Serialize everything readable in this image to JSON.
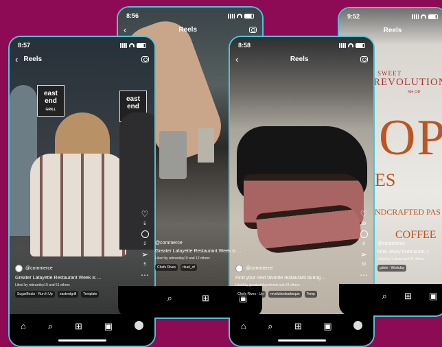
{
  "phones": [
    {
      "time": "8:57",
      "reels_title": "Reels",
      "handle": "@commerce",
      "caption": "Greater Lafayette Restaurant Week is ...",
      "liked": "Liked by rebrantley10 and 61 others",
      "chips": [
        "SugarBeats · Run It Up",
        "easterdgrill",
        "Template"
      ],
      "sign_text": "east end",
      "sign_sub": "GRILL",
      "rail_counts": [
        "5",
        "2",
        "5"
      ]
    },
    {
      "time": "8:56",
      "reels_title": "Reels",
      "handle": "@commerce",
      "caption": "Greater Lafayette Restaurant Week is ...",
      "liked": "Liked by rebrantley10 and 12 others",
      "chips": [
        "Chefs Rives",
        "rituel_of"
      ]
    },
    {
      "time": "8:58",
      "reels_title": "Reels",
      "handle": "@commerce",
      "caption": "Find your next favorite restaurant during ...",
      "liked": "Liked by greaterlafayettemd and 34 others",
      "chips": [
        "Chefs Rives · Up",
        "revolutionbarbeque",
        "Temp"
      ],
      "rail_counts": [
        "39",
        "8",
        "30"
      ]
    },
    {
      "time": "9:52",
      "reels_title": "Reels",
      "handle": "@commerce",
      "caption": "time, enjoy fixed-price, mult...",
      "liked": "Liked by 1 ideas and 47 others",
      "chips": [
        "gdole · Workday"
      ],
      "sign_top": "SWEET",
      "sign_main": "REVOLUTION",
      "sign_sub": "SH OP",
      "big_text": "OPE",
      "es_text": "ES",
      "crafted": "NDCRAFTED PAS",
      "coffee": "COFFEE"
    }
  ]
}
